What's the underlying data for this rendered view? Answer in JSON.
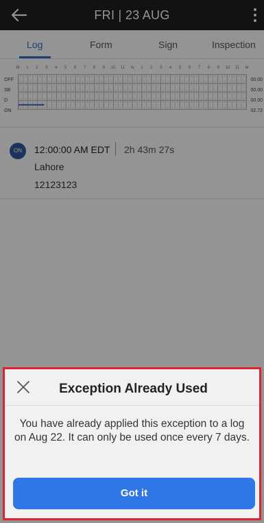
{
  "header": {
    "title": "FRI | 23 AUG"
  },
  "tabs": [
    {
      "label": "Log"
    },
    {
      "label": "Form"
    },
    {
      "label": "Sign"
    },
    {
      "label": "Inspection"
    }
  ],
  "grid": {
    "hour_labels": [
      "M",
      "1",
      "2",
      "3",
      "4",
      "5",
      "6",
      "7",
      "8",
      "9",
      "10",
      "11",
      "N",
      "1",
      "2",
      "3",
      "4",
      "5",
      "6",
      "7",
      "8",
      "9",
      "10",
      "11",
      "M"
    ],
    "rows": [
      {
        "label": "OFF",
        "total": "00.00"
      },
      {
        "label": "SB",
        "total": "00.00"
      },
      {
        "label": "D",
        "total": "00.00"
      },
      {
        "label": "ON",
        "total": "02.72"
      }
    ],
    "on_duty_line_color": "#2f6fc7"
  },
  "event": {
    "badge": "ON",
    "time": "12:00:00 AM EDT",
    "duration": "2h 43m 27s",
    "location": "Lahore",
    "note": "12123123"
  },
  "dialog": {
    "title": "Exception Already Used",
    "message": "You have already applied this exception to a log on Aug 22. It can only be used once every 7 days.",
    "button_label": "Got it"
  },
  "colors": {
    "accent": "#2f77e6",
    "highlight_border": "#e0222a",
    "appbar": "#1f1f1f"
  }
}
